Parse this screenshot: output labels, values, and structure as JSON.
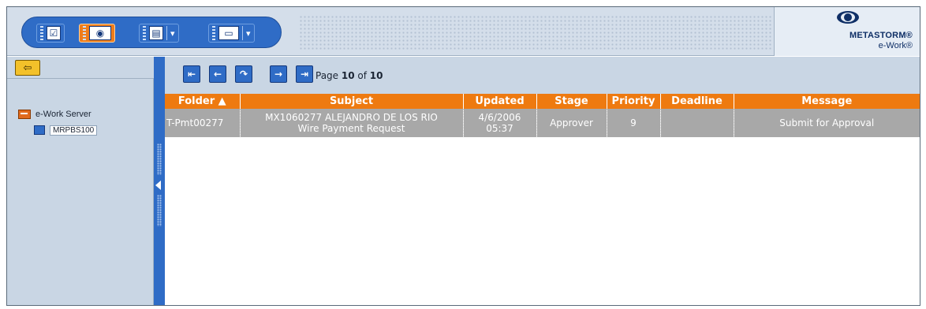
{
  "toolbar": {
    "buttons": [
      {
        "icon": "checkbox-icon",
        "glyph": "☑"
      },
      {
        "icon": "eye-icon",
        "glyph": "◉"
      },
      {
        "icon": "folder-list-icon",
        "glyph": "▤",
        "dropdown": "▾"
      },
      {
        "icon": "briefcase-icon",
        "glyph": "▭",
        "dropdown": "▾"
      }
    ]
  },
  "logo": {
    "name": "METASTORM®",
    "sub": "e-Work®"
  },
  "left": {
    "exit_glyph": "⇦",
    "tree": {
      "server_label": "e-Work Server",
      "node_label": "MRPBS100"
    }
  },
  "pager": {
    "first": "⇤",
    "prev": "←",
    "refresh": "↷",
    "next": "→",
    "last": "⇥",
    "prefix": "Page ",
    "current": "10",
    "of": " of ",
    "total": "10"
  },
  "table": {
    "columns": [
      "Folder ▲",
      "Subject",
      "Updated",
      "Stage",
      "Priority",
      "Deadline",
      "Message"
    ],
    "rows": [
      {
        "folder": "T-Pmt00277",
        "subject_line1": "MX1060277 ALEJANDRO DE LOS RIO",
        "subject_line2": "Wire Payment Request",
        "updated_line1": "4/6/2006",
        "updated_line2": "05:37",
        "stage": "Approver",
        "priority": "9",
        "deadline": "",
        "message": "Submit for Approval"
      }
    ]
  },
  "colors": {
    "accent": "#2f6cc6",
    "header_orange": "#ee7a10",
    "row_gray": "#a8a8a8",
    "panel_bg": "#c9d6e4"
  }
}
